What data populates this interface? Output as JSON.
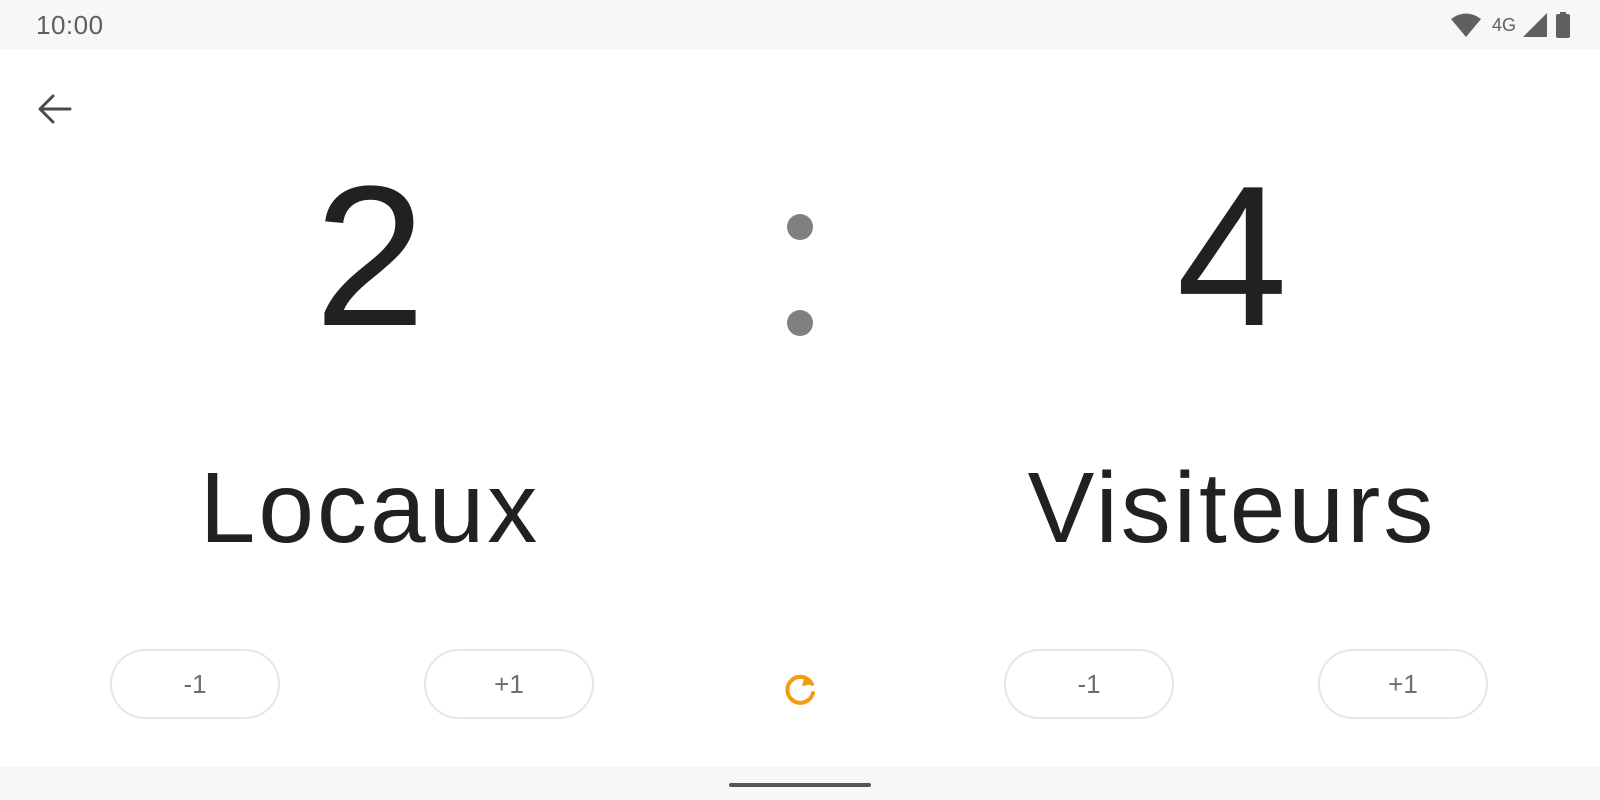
{
  "status_bar": {
    "time": "10:00",
    "network": "4G",
    "icons": [
      "wifi-icon",
      "signal-icon",
      "battery-icon"
    ]
  },
  "toolbar": {
    "back_icon": "arrow-left-icon"
  },
  "scoreboard": {
    "home": {
      "score": "2",
      "name": "Locaux"
    },
    "separator": ":",
    "away": {
      "score": "4",
      "name": "Visiteurs"
    }
  },
  "controls": {
    "home_minus": "-1",
    "home_plus": "+1",
    "reset_icon": "refresh-icon",
    "away_minus": "-1",
    "away_plus": "+1"
  },
  "colors": {
    "text": "#212121",
    "separator": "#808080",
    "accent": "#f39c12",
    "button_border": "#e6e6e6"
  }
}
